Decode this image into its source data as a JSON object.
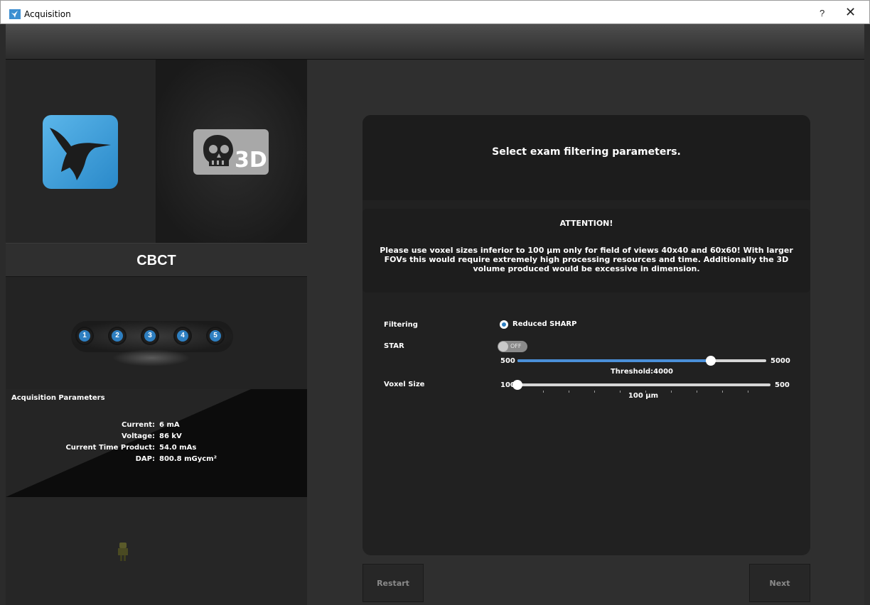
{
  "window": {
    "title": "Acquisition",
    "help": "?",
    "close": "✕"
  },
  "modes": {
    "tile_3d_label": "3D",
    "selected_label": "CBCT"
  },
  "steps": [
    "1",
    "2",
    "3",
    "4",
    "5"
  ],
  "acquisition": {
    "title": "Acquisition Parameters",
    "params": [
      {
        "key": "Current:",
        "value": "6 mA"
      },
      {
        "key": "Voltage:",
        "value": "86 kV"
      },
      {
        "key": "Current Time Product:",
        "value": "54.0 mAs"
      },
      {
        "key": "DAP:",
        "value": "800.8 mGycm²"
      }
    ]
  },
  "main": {
    "heading": "Select exam filtering parameters.",
    "attention_title": "ATTENTION!",
    "attention_body": "Please use voxel sizes inferior to 100 µm only for field of views 40x40 and 60x60! With larger FOVs this would require extremely high processing resources and time. Additionally the 3D volume produced would be excessive in dimension.",
    "filtering_label": "Filtering",
    "filtering_option": "Reduced SHARP",
    "star_label": "STAR",
    "star_state": "OFF",
    "threshold": {
      "min": "500",
      "max": "5000",
      "caption": "Threshold:4000",
      "value": 4000,
      "range": [
        500,
        5000
      ]
    },
    "voxel_label": "Voxel Size",
    "voxel": {
      "min": "100",
      "max": "500",
      "caption": "100 µm",
      "value": 100,
      "range": [
        100,
        500
      ]
    }
  },
  "buttons": {
    "restart": "Restart",
    "next": "Next"
  },
  "colors": {
    "accent": "#4a90d9",
    "step_blue": "#2e7fc1",
    "bird_blue": "#3fa0dc"
  },
  "icons": {
    "app": "bird-app-icon",
    "mode_2d": "hummingbird-icon",
    "mode_3d": "skull-3d-icon",
    "bottom": "device-icon"
  }
}
